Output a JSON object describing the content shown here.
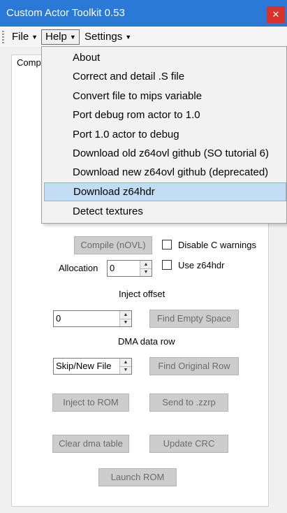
{
  "window": {
    "title": "Custom Actor Toolkit 0.53",
    "close_glyph": "✕",
    "accent": "#2b79d6",
    "close_color": "#d9322b"
  },
  "menubar": {
    "file": "File",
    "help": "Help",
    "settings": "Settings",
    "caret": "▼"
  },
  "panel": {
    "label": "Compi"
  },
  "help_menu": {
    "items": [
      "About",
      "Correct and detail .S file",
      "Convert file to mips variable",
      "Port debug rom actor to 1.0",
      "Port 1.0 actor to debug",
      "Download old z64ovl github (SO tutorial 6)",
      "Download new z64ovl github (deprecated)",
      "Download z64hdr",
      "Detect textures"
    ],
    "highlighted": "Download z64hdr"
  },
  "controls": {
    "compile_button": "Compile (nOVL)",
    "disable_c_warnings": "Disable C warnings",
    "use_z64hdr": "Use z64hdr",
    "allocation_label": "Allocation",
    "allocation_value": "0",
    "inject_offset_label": "Inject offset",
    "inject_offset_value": "0",
    "find_empty_space": "Find Empty Space",
    "dma_data_row_label": "DMA data row",
    "dma_row_value": "Skip/New File",
    "find_original_row": "Find Original Row",
    "inject_to_rom": "Inject to ROM",
    "send_to_zzrp": "Send to .zzrp",
    "clear_dma_table": "Clear dma table",
    "update_crc": "Update CRC",
    "launch_rom": "Launch ROM"
  }
}
